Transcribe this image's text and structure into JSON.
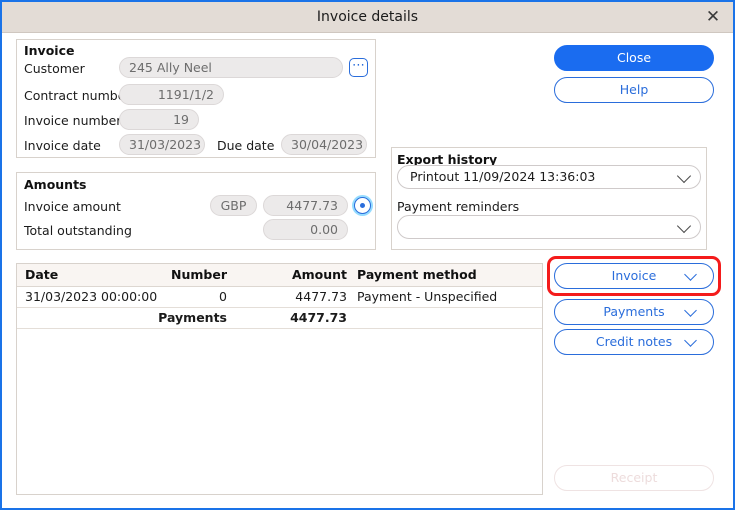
{
  "window": {
    "title": "Invoice details",
    "close_icon": "close-x-icon",
    "accent": "#1a6cf0",
    "titlebar_bg": "#e3dcd6",
    "highlight_color": "#f41b1b"
  },
  "invoice_group": {
    "title": "Invoice",
    "fields": [
      {
        "label": "Customer",
        "value": "245 Ally Neel"
      },
      {
        "label": "Contract number",
        "value": "1191/1/2"
      },
      {
        "label": "Invoice number",
        "value": "19"
      },
      {
        "label": "Invoice date",
        "value": "31/03/2023"
      },
      {
        "label": "Due date",
        "value": "30/04/2023"
      }
    ],
    "browse_icon": "ellipsis-icon"
  },
  "amounts_group": {
    "title": "Amounts",
    "invoice_amount_label": "Invoice amount",
    "currency": "GBP",
    "invoice_amount": "4477.73",
    "total_outstanding_label": "Total outstanding",
    "total_outstanding": "0.00",
    "amount_icon": "currency-circle-icon"
  },
  "export_group": {
    "title": "Export history",
    "export_value": "Printout 11/09/2024 13:36:03",
    "payment_reminders_label": "Payment reminders",
    "payment_reminders_value": "",
    "chevron_icon": "chevron-down-icon"
  },
  "buttons": {
    "close": "Close",
    "help": "Help",
    "invoice": "Invoice",
    "payments": "Payments",
    "credit_notes": "Credit notes",
    "receipt": "Receipt"
  },
  "table": {
    "headers": [
      "Date",
      "Number",
      "Amount",
      "Payment method"
    ],
    "rows": [
      {
        "date": "31/03/2023 00:00:00",
        "number": "0",
        "amount": "4477.73",
        "method": "Payment - Unspecified"
      }
    ],
    "total_row": {
      "date": "",
      "number": "Payments",
      "amount": "4477.73",
      "method": ""
    }
  }
}
